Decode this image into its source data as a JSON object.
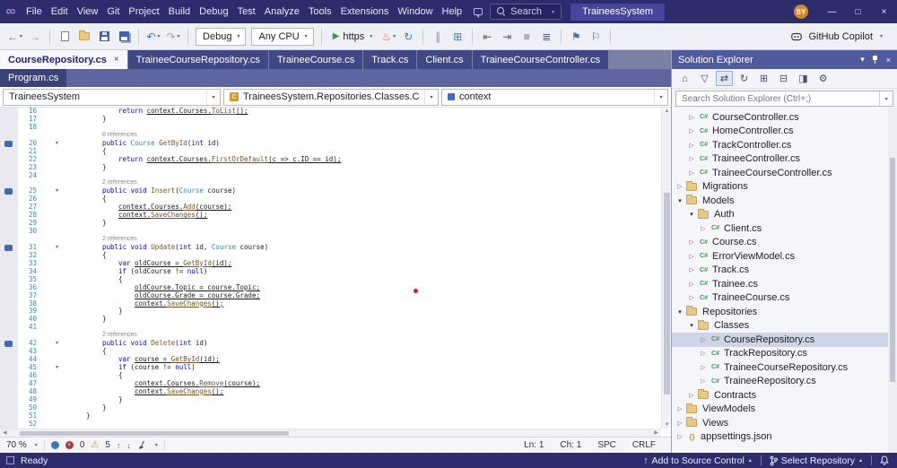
{
  "window_controls": {
    "minimize": "—",
    "maximize": "□",
    "close": "×"
  },
  "title_bar": {
    "menus": [
      "File",
      "Edit",
      "View",
      "Git",
      "Project",
      "Build",
      "Debug",
      "Test",
      "Analyze",
      "Tools",
      "Extensions",
      "Window",
      "Help"
    ],
    "search_label": "Search",
    "solution_name": "TraineesSystem",
    "avatar_initials": "SY"
  },
  "toolbar": {
    "copilot_label": "GitHub Copilot",
    "items": [
      {
        "t": "i",
        "name": "navigate-back-icon",
        "g": "←",
        "col": "#2a6ff0",
        "dd": 1
      },
      {
        "t": "i",
        "name": "navigate-forward-icon",
        "g": "→",
        "col": "#9aa2bc"
      },
      {
        "t": "sep"
      },
      {
        "t": "i",
        "name": "new-file-icon",
        "css": "ic-doc"
      },
      {
        "t": "i",
        "name": "open-file-icon",
        "css": "ic-folder2"
      },
      {
        "t": "i",
        "name": "save-icon",
        "css": "ic-save"
      },
      {
        "t": "i",
        "name": "save-all-icon",
        "css": "ic-saveall"
      },
      {
        "t": "sep"
      },
      {
        "t": "i",
        "name": "undo-icon",
        "g": "↶",
        "col": "#2a6ff0",
        "dd": 1
      },
      {
        "t": "i",
        "name": "redo-icon",
        "g": "↷",
        "col": "#9aa2bc",
        "dd": 1
      },
      {
        "t": "sep"
      },
      {
        "t": "combo",
        "name": "configuration-dropdown",
        "label": "Debug"
      },
      {
        "t": "combo",
        "name": "platform-dropdown",
        "label": "Any CPU"
      },
      {
        "t": "sep"
      },
      {
        "t": "run",
        "name": "start-debug-button",
        "label": "https"
      },
      {
        "t": "i",
        "name": "hot-reload-icon",
        "g": "♨",
        "col": "#d2622a",
        "dd": 1
      },
      {
        "t": "i",
        "name": "restart-icon",
        "g": "↻",
        "col": "#2e86c1"
      },
      {
        "t": "sep"
      },
      {
        "t": "i",
        "name": "break-all-icon",
        "g": "∥",
        "col": "#8a90a8"
      },
      {
        "t": "i",
        "name": "test-explorer-icon",
        "g": "⊞",
        "col": "#3a76c4"
      },
      {
        "t": "sep"
      },
      {
        "t": "i",
        "name": "indent-decrease-icon",
        "g": "⇤",
        "col": "#5a6176"
      },
      {
        "t": "i",
        "name": "indent-increase-icon",
        "g": "⇥",
        "col": "#5a6176"
      },
      {
        "t": "i",
        "name": "comment-icon",
        "g": "≡",
        "col": "#5a6176"
      },
      {
        "t": "i",
        "name": "uncomment-icon",
        "g": "≣",
        "col": "#5a6176"
      },
      {
        "t": "sep"
      },
      {
        "t": "i",
        "name": "bookmark-toggle-icon",
        "g": "⚑",
        "col": "#3a76c4"
      },
      {
        "t": "i",
        "name": "bookmark-list-icon",
        "g": "⚐",
        "col": "#5a6176"
      },
      {
        "t": "sep"
      }
    ]
  },
  "tabs": {
    "row1": [
      {
        "label": "CourseRepository.cs",
        "active": true
      },
      {
        "label": "TraineeCourseRepository.cs"
      },
      {
        "label": "TraineeCourse.cs"
      },
      {
        "label": "Track.cs"
      },
      {
        "label": "Client.cs"
      },
      {
        "label": "TraineeCourseController.cs"
      }
    ],
    "row2": [
      {
        "label": "Program.cs"
      }
    ]
  },
  "navbar": {
    "project": "TraineesSystem",
    "type_path": "TraineesSystem.Repositories.Classes.CourseRepositor",
    "member": "context"
  },
  "editor": {
    "lines": [
      {
        "n": 16,
        "i": 12,
        "s": [
          [
            "k",
            "return ",
            0
          ],
          [
            "pl",
            "context.Courses.",
            1
          ],
          [
            "me",
            "ToList",
            1
          ],
          [
            "pl",
            "();",
            1
          ]
        ]
      },
      {
        "n": 17,
        "i": 8,
        "s": [
          [
            "pl",
            "}",
            0
          ]
        ]
      },
      {
        "n": 18,
        "s": []
      },
      {
        "L": "6 references",
        "i": 8
      },
      {
        "n": 20,
        "i": 8,
        "b": 1,
        "c": 1,
        "s": [
          [
            "k",
            "public ",
            0
          ],
          [
            "ty",
            "Course ",
            0
          ],
          [
            "me",
            "GetById",
            0
          ],
          [
            "pl",
            "(",
            0
          ],
          [
            "k",
            "int",
            0
          ],
          [
            "pl",
            " id)",
            0
          ]
        ]
      },
      {
        "n": 21,
        "i": 8,
        "s": [
          [
            "pl",
            "{",
            0
          ]
        ]
      },
      {
        "n": 22,
        "i": 12,
        "s": [
          [
            "k",
            "return ",
            0
          ],
          [
            "pl",
            "context.Courses.",
            1
          ],
          [
            "me",
            "FirstOrDefault",
            1
          ],
          [
            "pl",
            "(c => c.ID == id);",
            1
          ]
        ]
      },
      {
        "n": 23,
        "i": 8,
        "s": [
          [
            "pl",
            "}",
            0
          ]
        ]
      },
      {
        "n": 24,
        "s": []
      },
      {
        "L": "2 references",
        "i": 8
      },
      {
        "n": 25,
        "i": 8,
        "b": 1,
        "c": 1,
        "s": [
          [
            "k",
            "public void ",
            0
          ],
          [
            "me",
            "Insert",
            0
          ],
          [
            "pl",
            "(",
            0
          ],
          [
            "ty",
            "Course",
            0
          ],
          [
            "pl",
            " course)",
            0
          ]
        ]
      },
      {
        "n": 26,
        "i": 8,
        "s": [
          [
            "pl",
            "{",
            0
          ]
        ]
      },
      {
        "n": 27,
        "i": 12,
        "s": [
          [
            "pl",
            "context.Courses.",
            1
          ],
          [
            "me",
            "Add",
            1
          ],
          [
            "pl",
            "(course);",
            1
          ]
        ]
      },
      {
        "n": 28,
        "i": 12,
        "s": [
          [
            "pl",
            "context.",
            1
          ],
          [
            "me",
            "SaveChanges",
            1
          ],
          [
            "pl",
            "();",
            1
          ]
        ]
      },
      {
        "n": 29,
        "i": 8,
        "s": [
          [
            "pl",
            "}",
            0
          ]
        ]
      },
      {
        "n": 30,
        "s": []
      },
      {
        "L": "2 references",
        "i": 8
      },
      {
        "n": 31,
        "i": 8,
        "b": 1,
        "c": 1,
        "s": [
          [
            "k",
            "public void ",
            0
          ],
          [
            "me",
            "Update",
            0
          ],
          [
            "pl",
            "(",
            0
          ],
          [
            "k",
            "int",
            0
          ],
          [
            "pl",
            " id, ",
            0
          ],
          [
            "ty",
            "Course",
            0
          ],
          [
            "pl",
            " course)",
            0
          ]
        ]
      },
      {
        "n": 32,
        "i": 8,
        "s": [
          [
            "pl",
            "{",
            0
          ]
        ]
      },
      {
        "n": 33,
        "i": 12,
        "s": [
          [
            "k",
            "var ",
            0
          ],
          [
            "pl",
            "oldCourse = ",
            1
          ],
          [
            "me",
            "GetById",
            1
          ],
          [
            "pl",
            "(id);",
            1
          ]
        ]
      },
      {
        "n": 34,
        "i": 12,
        "s": [
          [
            "k",
            "if ",
            0
          ],
          [
            "pl",
            "(oldCourse != ",
            0
          ],
          [
            "k",
            "null",
            0
          ],
          [
            "pl",
            ")",
            0
          ]
        ]
      },
      {
        "n": 35,
        "i": 12,
        "s": [
          [
            "pl",
            "{",
            0
          ]
        ]
      },
      {
        "n": 36,
        "i": 16,
        "s": [
          [
            "pl",
            "oldCourse.Topic = course.Topic;",
            1
          ]
        ]
      },
      {
        "n": 37,
        "i": 16,
        "s": [
          [
            "pl",
            "oldCourse.Grade = course.Grade;",
            1
          ]
        ]
      },
      {
        "n": 38,
        "i": 16,
        "s": [
          [
            "pl",
            "context.",
            1
          ],
          [
            "me",
            "SaveChanges",
            1
          ],
          [
            "pl",
            "();",
            1
          ]
        ]
      },
      {
        "n": 39,
        "i": 12,
        "s": [
          [
            "pl",
            "}",
            0
          ]
        ]
      },
      {
        "n": 40,
        "i": 8,
        "s": [
          [
            "pl",
            "}",
            0
          ]
        ]
      },
      {
        "n": 41,
        "s": []
      },
      {
        "L": "2 references",
        "i": 8
      },
      {
        "n": 42,
        "i": 8,
        "b": 1,
        "c": 1,
        "s": [
          [
            "k",
            "public void ",
            0
          ],
          [
            "me",
            "Delete",
            0
          ],
          [
            "pl",
            "(",
            0
          ],
          [
            "k",
            "int",
            0
          ],
          [
            "pl",
            " id)",
            0
          ]
        ]
      },
      {
        "n": 43,
        "i": 8,
        "s": [
          [
            "pl",
            "{",
            0
          ]
        ]
      },
      {
        "n": 44,
        "i": 12,
        "s": [
          [
            "k",
            "var ",
            0
          ],
          [
            "pl",
            "course = ",
            1
          ],
          [
            "me",
            "GetById",
            1
          ],
          [
            "pl",
            "(id);",
            1
          ]
        ]
      },
      {
        "n": 45,
        "i": 12,
        "c": 1,
        "s": [
          [
            "k",
            "if ",
            0
          ],
          [
            "pl",
            "(course != ",
            0
          ],
          [
            "k",
            "null",
            0
          ],
          [
            "pl",
            ")",
            0
          ]
        ]
      },
      {
        "n": 46,
        "i": 12,
        "s": [
          [
            "pl",
            "{",
            0
          ]
        ]
      },
      {
        "n": 47,
        "i": 16,
        "s": [
          [
            "pl",
            "context.Courses.",
            1
          ],
          [
            "me",
            "Remove",
            1
          ],
          [
            "pl",
            "(course);",
            1
          ]
        ]
      },
      {
        "n": 48,
        "i": 16,
        "s": [
          [
            "pl",
            "context.",
            1
          ],
          [
            "me",
            "SaveChanges",
            1
          ],
          [
            "pl",
            "();",
            1
          ]
        ]
      },
      {
        "n": 49,
        "i": 12,
        "s": [
          [
            "pl",
            "}",
            0
          ]
        ]
      },
      {
        "n": 50,
        "i": 8,
        "s": [
          [
            "pl",
            "}",
            0
          ]
        ]
      },
      {
        "n": 51,
        "i": 4,
        "s": [
          [
            "pl",
            "}",
            0
          ]
        ]
      },
      {
        "n": 52,
        "s": []
      }
    ]
  },
  "status_strip": {
    "zoom": "70 %",
    "errors": "0",
    "warnings": "5",
    "line": "Ln: 1",
    "column": "Ch: 1",
    "spaces": "SPC",
    "line_ending": "CRLF"
  },
  "solution_explorer": {
    "title": "Solution Explorer",
    "search_placeholder": "Search Solution Explorer (Ctrl+;)",
    "header_icons": [
      {
        "name": "window-position-icon",
        "g": "▾"
      },
      {
        "name": "pin-icon",
        "css": "pin"
      },
      {
        "name": "close-icon",
        "g": "×"
      }
    ],
    "toolbar_icons": [
      {
        "name": "home-icon",
        "g": "⌂"
      },
      {
        "name": "pending-filter-icon",
        "g": "▽"
      },
      {
        "name": "sync-active-document-icon",
        "g": "⇄",
        "hl": 1
      },
      {
        "name": "refresh-icon",
        "g": "↻"
      },
      {
        "name": "show-all-files-icon",
        "g": "⊞"
      },
      {
        "name": "collapse-all-icon",
        "g": "⊟"
      },
      {
        "name": "preview-icon",
        "g": "◨"
      },
      {
        "name": "properties-icon",
        "g": "⚙"
      }
    ],
    "items": [
      {
        "label": "CourseController.cs",
        "lvl": 3,
        "icon": "cs"
      },
      {
        "label": "HomeController.cs",
        "lvl": 3,
        "icon": "cs"
      },
      {
        "label": "TrackController.cs",
        "lvl": 3,
        "icon": "cs"
      },
      {
        "label": "TraineeController.cs",
        "lvl": 3,
        "icon": "cs"
      },
      {
        "label": "TraineeCourseController.cs",
        "lvl": 3,
        "icon": "cs"
      },
      {
        "label": "Migrations",
        "lvl": 2,
        "icon": "folder"
      },
      {
        "label": "Models",
        "lvl": 2,
        "icon": "folder",
        "exp": 1
      },
      {
        "label": "Auth",
        "lvl": 3,
        "icon": "folder",
        "exp": 1
      },
      {
        "label": "Client.cs",
        "lvl": 4,
        "icon": "cs"
      },
      {
        "label": "Course.cs",
        "lvl": 3,
        "icon": "cs"
      },
      {
        "label": "ErrorViewModel.cs",
        "lvl": 3,
        "icon": "cs"
      },
      {
        "label": "Track.cs",
        "lvl": 3,
        "icon": "cs"
      },
      {
        "label": "Trainee.cs",
        "lvl": 3,
        "icon": "cs"
      },
      {
        "label": "TraineeCourse.cs",
        "lvl": 3,
        "icon": "cs"
      },
      {
        "label": "Repositories",
        "lvl": 2,
        "icon": "folder",
        "exp": 1
      },
      {
        "label": "Classes",
        "lvl": 3,
        "icon": "folder",
        "exp": 1
      },
      {
        "label": "CourseRepository.cs",
        "lvl": 4,
        "icon": "cs",
        "sel": 1
      },
      {
        "label": "TrackRepository.cs",
        "lvl": 4,
        "icon": "cs"
      },
      {
        "label": "TraineeCourseRepository.cs",
        "lvl": 4,
        "icon": "cs"
      },
      {
        "label": "TraineeRepository.cs",
        "lvl": 4,
        "icon": "cs"
      },
      {
        "label": "Contracts",
        "lvl": 3,
        "icon": "folder"
      },
      {
        "label": "ViewModels",
        "lvl": 2,
        "icon": "folder"
      },
      {
        "label": "Views",
        "lvl": 2,
        "icon": "folder"
      },
      {
        "label": "appsettings.json",
        "lvl": 2,
        "icon": "json"
      }
    ]
  },
  "status_bar": {
    "ready": "Ready",
    "add_source_control": "Add to Source Control",
    "select_repository": "Select Repository"
  },
  "colors": {
    "title_bar": "#2d2d6e",
    "tab_strip": "#7a81a5",
    "inactive_tab": "#3f4885",
    "active_tab_bg": "#f8f8fc",
    "keyword": "#0000f0",
    "type_name": "#2b91af",
    "method_name": "#74531f",
    "line_number": "#2b91af",
    "codelens": "#8a8a8a",
    "error_red": "#b5383d",
    "warning_yellow": "#c29a18",
    "folder": "#e9c982",
    "csharp_green": "#399b4c",
    "selection_bg": "#cfd5e6",
    "run_green": "#2f9e44",
    "avatar_orange": "#d8882a"
  }
}
